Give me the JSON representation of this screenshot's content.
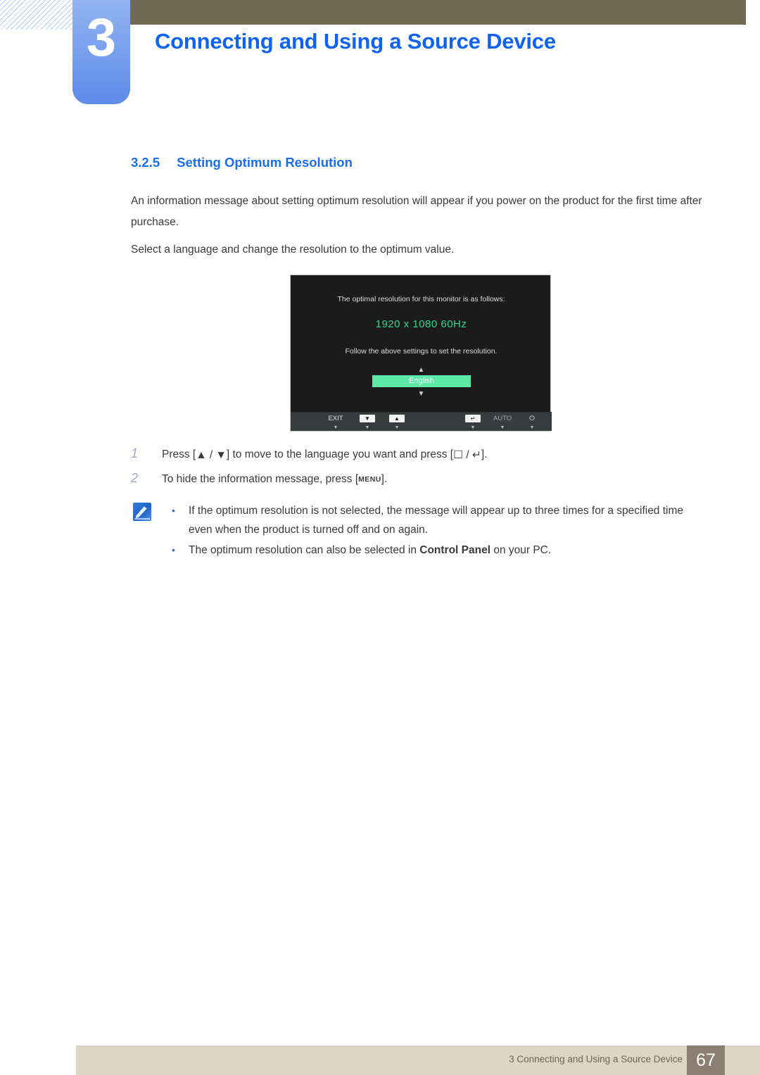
{
  "chapter": {
    "number": "3",
    "title": "Connecting and Using a Source Device"
  },
  "section": {
    "number": "3.2.5",
    "title": "Setting Optimum Resolution"
  },
  "body": {
    "paragraph_1": "An information message about setting optimum resolution will appear if you power on the product for the first time after purchase.",
    "paragraph_2": "Select a language and change the resolution to the optimum value."
  },
  "osd": {
    "line_1": "The optimal resolution for this monitor is as follows:",
    "resolution": "1920 x 1080  60Hz",
    "line_2": "Follow the above settings to set the resolution.",
    "arrow_up": "▲",
    "arrow_down": "▼",
    "language": "English",
    "colors": {
      "panel_bg": "#1b1b1b",
      "resolution_green": "#2fd68a",
      "highlight_green": "#5ce9a6",
      "button_bar": "#373c3d"
    },
    "buttons": [
      {
        "label": "EXIT",
        "tick": "▼",
        "type": "text"
      },
      {
        "label": "▼",
        "tick": "▼",
        "type": "box"
      },
      {
        "label": "▲",
        "tick": "▼",
        "type": "box"
      },
      {
        "label": "↵",
        "tick": "▼",
        "type": "box"
      },
      {
        "label": "AUTO",
        "tick": "▼",
        "type": "text-dim"
      },
      {
        "label": "⏻",
        "tick": "▼",
        "type": "text"
      }
    ]
  },
  "steps": [
    {
      "index": "1",
      "text_before": "Press [",
      "keys_1": "▲ / ▼",
      "text_middle": "] to move to the language you want and press [",
      "keys_2": "☐ / ↵",
      "text_after": "]."
    },
    {
      "index": "2",
      "text_before": "To hide the information message, press [",
      "key": "MENU",
      "text_after": "]."
    }
  ],
  "notes": {
    "icon": "note-pen-icon",
    "bullets": [
      {
        "text": "If the optimum resolution is not selected, the message will appear up to three times for a specified time even when the product is turned off and on again."
      },
      {
        "text_before": "The optimum resolution can also be selected in ",
        "bold": "Control Panel",
        "text_after": " on your PC."
      }
    ]
  },
  "footer": {
    "text": "3 Connecting and Using a Source Device",
    "page": "67"
  },
  "colors": {
    "header_olive": "#6e6a54",
    "chapter_blue": "#1062f0",
    "section_blue": "#1a6fe8",
    "footer_bg": "#ddd6c3",
    "footer_page_bg": "#8b7f71"
  }
}
